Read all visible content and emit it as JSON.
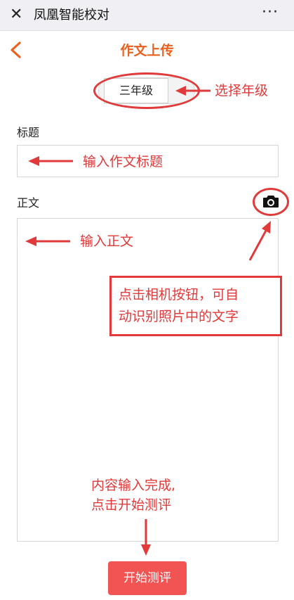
{
  "app": {
    "title": "凤凰智能校对",
    "close_glyph": "✕",
    "more_glyph": "···"
  },
  "page": {
    "title": "作文上传"
  },
  "grade": {
    "value": "三年级"
  },
  "form": {
    "title_label": "标题",
    "body_label": "正文"
  },
  "annotations": {
    "grade": "选择年级",
    "title": "输入作文标题",
    "body": "输入正文",
    "camera_line1": "点击相机按钮，可自",
    "camera_line2": "动识别照片中的文字",
    "finish_line1": "内容输入完成,",
    "finish_line2": "点击开始测评"
  },
  "actions": {
    "start_label": "开始测评"
  },
  "icons": {
    "close": "close-icon",
    "more": "more-icon",
    "back": "back-chevron-icon",
    "camera": "camera-icon"
  },
  "colors": {
    "accent": "#e8611e",
    "annotation": "#e03a3a",
    "button": "#f25454",
    "topbar": "#efeff4"
  }
}
